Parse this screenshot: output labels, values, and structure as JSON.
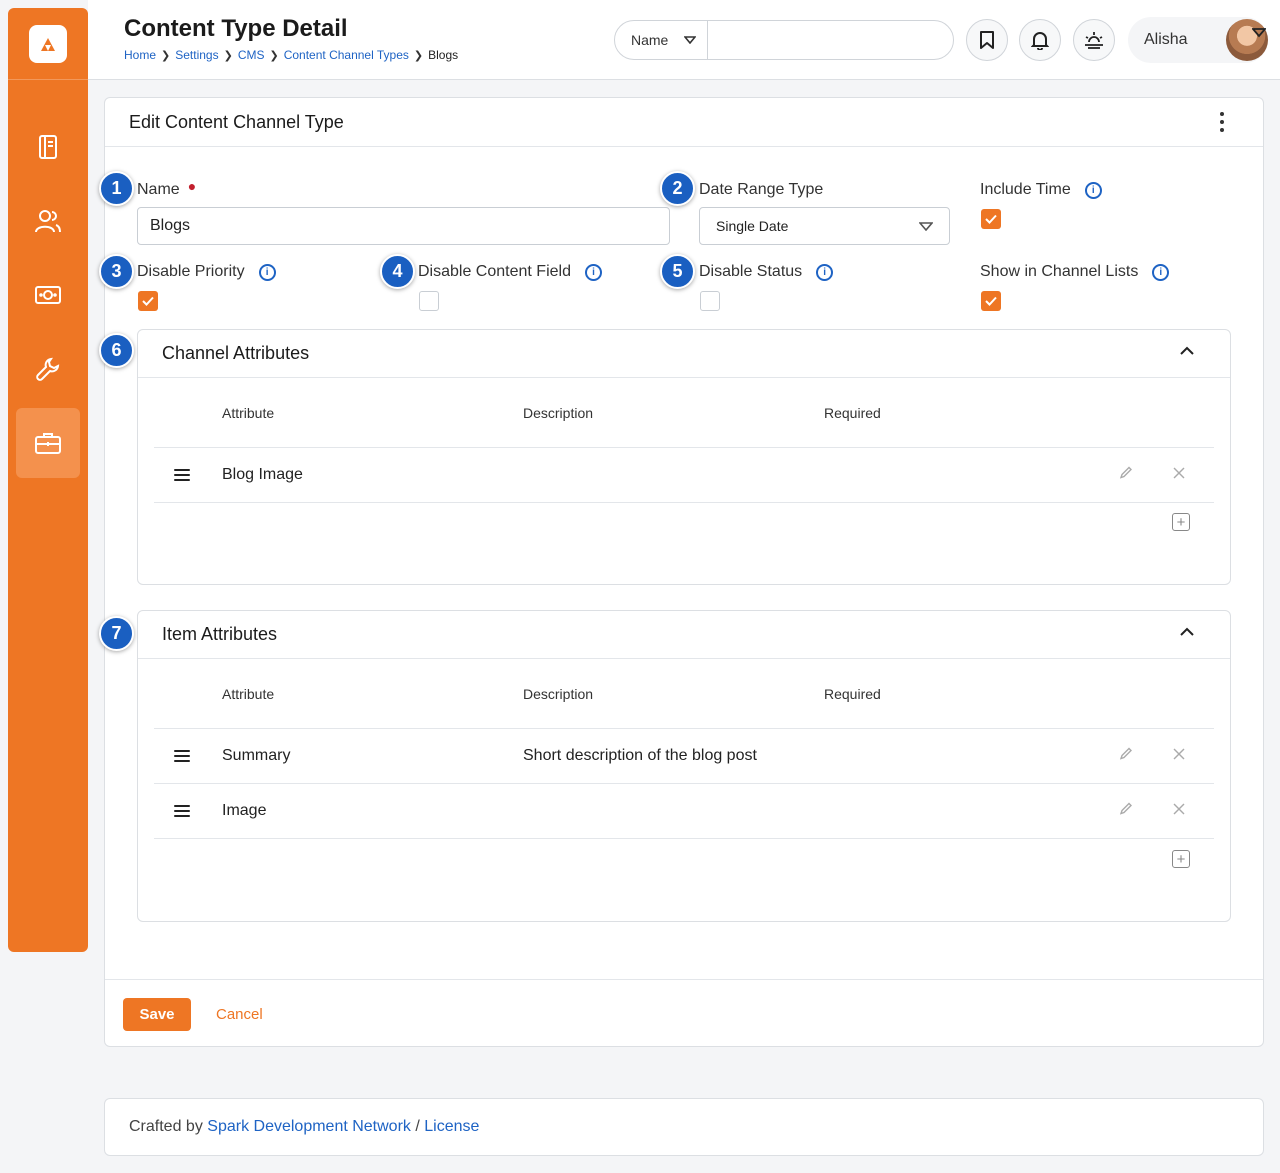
{
  "header": {
    "title": "Content Type Detail",
    "breadcrumbs": [
      "Home",
      "Settings",
      "CMS",
      "Content Channel Types"
    ],
    "breadcrumb_current": "Blogs",
    "search_type": "Name",
    "search_value": "",
    "user_name": "Alisha"
  },
  "panel": {
    "title": "Edit Content Channel Type",
    "name_label": "Name",
    "name_value": "Blogs",
    "date_range_label": "Date Range Type",
    "date_range_value": "Single Date",
    "include_time_label": "Include Time",
    "include_time_checked": true,
    "disable_priority_label": "Disable Priority",
    "disable_priority_checked": true,
    "disable_content_label": "Disable Content Field",
    "disable_content_checked": false,
    "disable_status_label": "Disable Status",
    "disable_status_checked": false,
    "show_in_lists_label": "Show in Channel Lists",
    "show_in_lists_checked": true
  },
  "badges": [
    "1",
    "2",
    "3",
    "4",
    "5",
    "6",
    "7"
  ],
  "channel_attributes": {
    "title": "Channel Attributes",
    "columns": [
      "Attribute",
      "Description",
      "Required"
    ],
    "rows": [
      {
        "attribute": "Blog Image",
        "description": "",
        "required": ""
      }
    ]
  },
  "item_attributes": {
    "title": "Item Attributes",
    "columns": [
      "Attribute",
      "Description",
      "Required"
    ],
    "rows": [
      {
        "attribute": "Summary",
        "description": "Short description of the blog post",
        "required": ""
      },
      {
        "attribute": "Image",
        "description": "",
        "required": ""
      }
    ]
  },
  "actions": {
    "save_label": "Save",
    "cancel_label": "Cancel"
  },
  "footer": {
    "prefix": "Crafted by",
    "org_link": "Spark Development Network",
    "separator": "/",
    "license_link": "License"
  },
  "colors": {
    "brand": "#ee7624",
    "link": "#1e63c4",
    "badge": "#1a5fc1"
  }
}
